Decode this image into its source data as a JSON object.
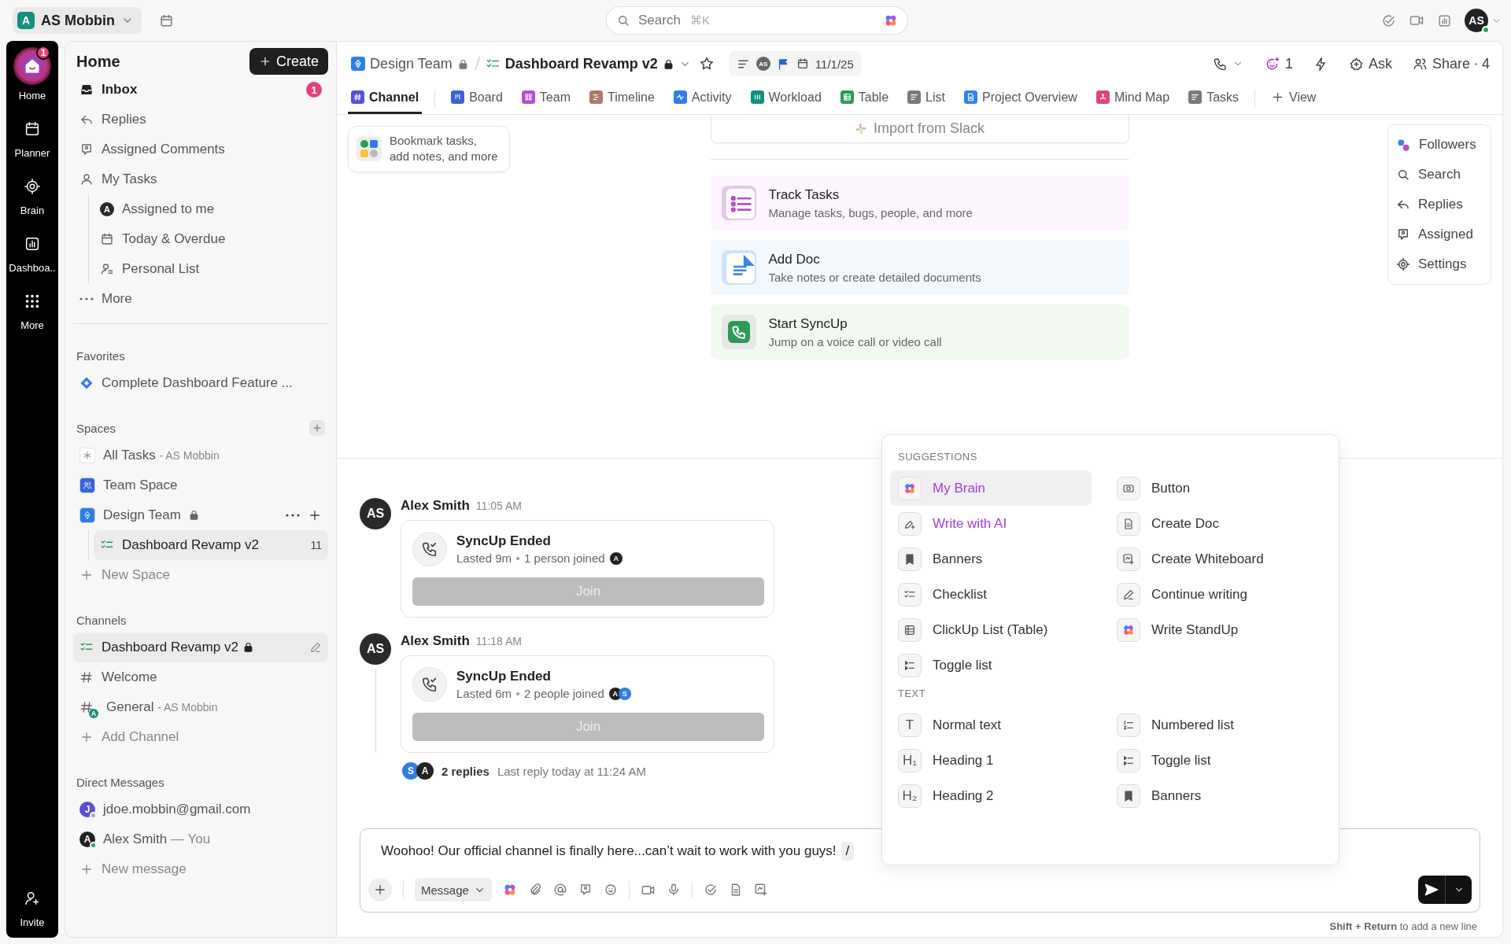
{
  "workspace": {
    "initial": "A",
    "name": "AS Mobbin"
  },
  "search": {
    "placeholder": "Search",
    "shortcut": "⌘K"
  },
  "user": {
    "initials": "AS",
    "online": true
  },
  "rail": [
    {
      "label": "Home",
      "selected": true,
      "badge": "1"
    },
    {
      "label": "Planner",
      "selected": false
    },
    {
      "label": "Brain",
      "selected": false
    },
    {
      "label": "Dashboa..",
      "selected": false
    },
    {
      "label": "More",
      "selected": false
    }
  ],
  "rail_invite": "Invite",
  "sidebar": {
    "title": "Home",
    "create_button": "Create",
    "items": [
      {
        "label": "Inbox",
        "unread": true,
        "badge": "1"
      },
      {
        "label": "Replies",
        "unread": false
      },
      {
        "label": "Assigned Comments",
        "unread": false
      },
      {
        "label": "My Tasks",
        "unread": false,
        "children": [
          {
            "label": "Assigned to me",
            "avatar": "A"
          },
          {
            "label": "Today & Overdue"
          },
          {
            "label": "Personal List"
          }
        ]
      },
      {
        "label": "More",
        "unread": false
      }
    ],
    "favorites": {
      "heading": "Favorites",
      "items": [
        {
          "label": "Complete Dashboard Feature ..."
        }
      ]
    },
    "spaces": {
      "heading": "Spaces",
      "items": [
        {
          "label": "All Tasks",
          "suffix": "- AS Mobbin",
          "locked": false
        },
        {
          "label": "Team Space",
          "locked": false
        },
        {
          "label": "Design Team",
          "locked": true,
          "children": [
            {
              "label": "Dashboard Revamp v2",
              "count": "11",
              "selected": true
            }
          ]
        }
      ],
      "new_item": "New Space"
    },
    "channels": {
      "heading": "Channels",
      "items": [
        {
          "label": "Dashboard Revamp v2",
          "locked": true,
          "selected": true
        },
        {
          "label": "Welcome",
          "locked": false,
          "selected": false
        },
        {
          "label": "General",
          "suffix": "- AS Mobbin",
          "badge": "A",
          "locked": false,
          "selected": false
        }
      ],
      "new_item": "Add Channel"
    },
    "direct_messages": {
      "heading": "Direct Messages",
      "items": [
        {
          "initial": "J",
          "name": "jdoe.mobbin@gmail.com",
          "color": "#5b4fd6",
          "online": false
        },
        {
          "initial": "A",
          "name": "Alex Smith",
          "suffix": "— You",
          "color": "#222222",
          "online": true
        }
      ],
      "new_item": "New message"
    }
  },
  "header": {
    "space": "Design Team",
    "space_locked": true,
    "page": "Dashboard Revamp v2",
    "page_locked": true,
    "assignee": "AS",
    "due_date": "11/1/25",
    "ai_count": "1",
    "ask": "Ask",
    "share": "Share",
    "share_count": "4"
  },
  "tabs": [
    {
      "label": "Channel",
      "selected": true,
      "color": "#5b4fd6"
    },
    {
      "label": "Board",
      "selected": false,
      "color": "#3b63d9"
    },
    {
      "label": "Team",
      "selected": false,
      "color": "#b94fd3"
    },
    {
      "label": "Timeline",
      "selected": false,
      "color": "#a9796a"
    },
    {
      "label": "Activity",
      "selected": false,
      "color": "#2f7ee8"
    },
    {
      "label": "Workload",
      "selected": false,
      "color": "#14907e"
    },
    {
      "label": "Table",
      "selected": false,
      "color": "#2d9b57"
    },
    {
      "label": "List",
      "selected": false,
      "color": "#7a7a7a"
    },
    {
      "label": "Project Overview",
      "selected": false,
      "color": "#2d83f0"
    },
    {
      "label": "Mind Map",
      "selected": false,
      "color": "#e0447a"
    },
    {
      "label": "Tasks",
      "selected": false,
      "color": "#7a7a7a"
    }
  ],
  "add_view": "View",
  "bookmark_hint": "Bookmark tasks,\nadd notes, and more",
  "import_button": "Import from Slack",
  "quick_actions": [
    {
      "kind": "tasks",
      "title": "Track Tasks",
      "description": "Manage tasks, bugs, people, and more"
    },
    {
      "kind": "doc",
      "title": "Add Doc",
      "description": "Take notes or create detailed documents"
    },
    {
      "kind": "syncup",
      "title": "Start SyncUp",
      "description": "Jump on a voice call or video call"
    }
  ],
  "side_panel": [
    "Followers",
    "Search",
    "Replies",
    "Assigned",
    "Settings"
  ],
  "messages": [
    {
      "avatar": "AS",
      "author": "Alex Smith",
      "time": "11:05 AM",
      "card": {
        "title": "SyncUp Ended",
        "lasted": "Lasted 9m",
        "joined": "1 person joined",
        "participants": [
          {
            "initial": "A",
            "color": "#222222"
          }
        ],
        "button": "Join",
        "disabled": true
      }
    },
    {
      "avatar": "AS",
      "author": "Alex Smith",
      "time": "11:18 AM",
      "card": {
        "title": "SyncUp Ended",
        "lasted": "Lasted 6m",
        "joined": "2 people joined",
        "participants": [
          {
            "initial": "A",
            "color": "#222222"
          },
          {
            "initial": "S",
            "color": "#2f7ee8"
          }
        ],
        "button": "Join",
        "disabled": true
      },
      "thread": {
        "avatars": [
          {
            "initial": "S",
            "color": "#2f7ee8"
          },
          {
            "initial": "A",
            "color": "#222222"
          }
        ],
        "count": "2 replies",
        "last": "Last reply today at 11:24 AM"
      }
    }
  ],
  "slash_menu": [
    {
      "heading": "SUGGESTIONS",
      "items": [
        {
          "label": "My Brain",
          "selected": true,
          "accent": true
        },
        {
          "label": "Button",
          "selected": false,
          "accent": false
        },
        {
          "label": "Write with AI",
          "selected": false,
          "accent": true
        },
        {
          "label": "Create Doc",
          "selected": false,
          "accent": false
        },
        {
          "label": "Banners",
          "selected": false,
          "accent": false
        },
        {
          "label": "Create Whiteboard",
          "selected": false,
          "accent": false
        },
        {
          "label": "Checklist",
          "selected": false,
          "accent": false
        },
        {
          "label": "Continue writing",
          "selected": false,
          "accent": false
        },
        {
          "label": "ClickUp List (Table)",
          "selected": false,
          "accent": false
        },
        {
          "label": "Write StandUp",
          "selected": false,
          "accent": false
        },
        {
          "label": "Toggle list",
          "selected": false,
          "accent": false
        }
      ]
    },
    {
      "heading": "TEXT",
      "items": [
        {
          "label": "Normal text",
          "selected": false,
          "accent": false,
          "glyph": "T"
        },
        {
          "label": "Numbered list",
          "selected": false,
          "accent": false
        },
        {
          "label": "Heading 1",
          "selected": false,
          "accent": false,
          "glyph": "H₁"
        },
        {
          "label": "Toggle list",
          "selected": false,
          "accent": false
        },
        {
          "label": "Heading 2",
          "selected": false,
          "accent": false,
          "glyph": "H₂"
        },
        {
          "label": "Banners",
          "selected": false,
          "accent": false
        }
      ]
    }
  ],
  "composer": {
    "value": "Woohoo! Our official channel is finally here...can’t wait to work with you guys!",
    "command": "/",
    "mode": "Message"
  },
  "hint": "**Shift + Return** to add a new line"
}
